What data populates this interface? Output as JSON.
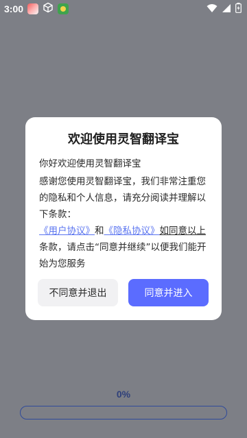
{
  "status_bar": {
    "time": "3:00",
    "icons": [
      "notification-app-icon",
      "cube-icon",
      "game-app-icon",
      "wifi-icon",
      "signal-icon",
      "battery-icon"
    ]
  },
  "dialog": {
    "title": "欢迎使用灵智翻译宝",
    "greeting": "你好欢迎使用灵智翻译宝",
    "paragraph1": "感谢您使用灵智翻译宝，我们非常注重您的隐私和个人信息，请充分阅读并理解以下条款：",
    "link_user_agreement": "《用户协议》",
    "conjunction": "和",
    "link_privacy_policy": "《隐私协议》",
    "agree_prefix": "如同意以上",
    "paragraph2_rest": "条款，请点击“同意并继续”以便我们能开始为您服务",
    "decline_button": "不同意并退出",
    "accept_button": "同意并进入"
  },
  "progress": {
    "label": "0%",
    "value": 0
  },
  "colors": {
    "accent": "#5b6cff",
    "link": "#5a74f0",
    "overlay": "#7d7f86"
  }
}
